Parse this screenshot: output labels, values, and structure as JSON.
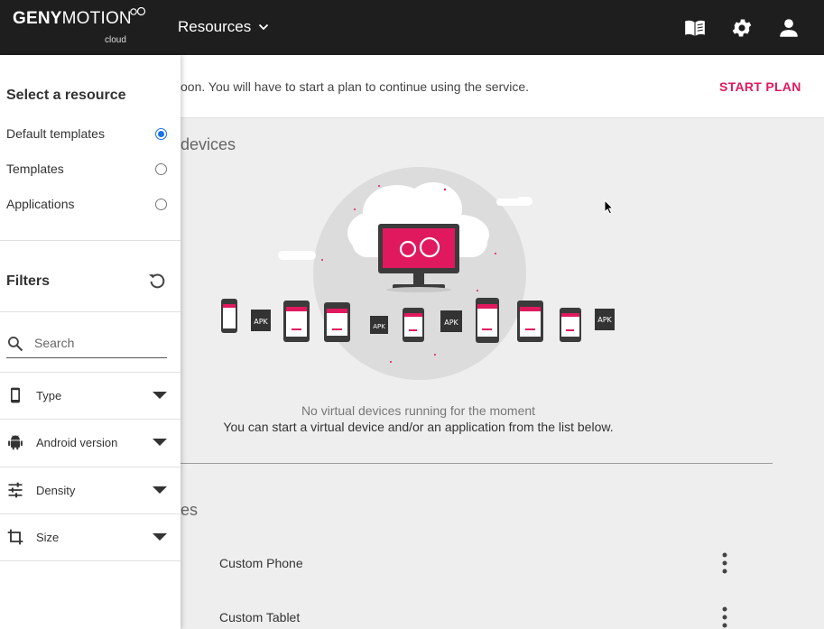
{
  "header": {
    "logo_word_bold": "GENY",
    "logo_word_light": "MOTION",
    "logo_sub": "cloud",
    "nav_label": "Resources",
    "icons": [
      "docs-book-icon",
      "settings-gear-icon",
      "account-person-icon"
    ]
  },
  "banner": {
    "text": "oon. You will have to start a plan to continue using the service.",
    "action": "START PLAN"
  },
  "main": {
    "section1_title": "devices",
    "section2_title": "es",
    "empty_line1": "No virtual devices running for the moment",
    "empty_line2": "You can start a virtual device and/or an application from the list below.",
    "apk_label": "APK",
    "templates": [
      {
        "name": "Custom Phone"
      },
      {
        "name": "Custom Tablet"
      }
    ]
  },
  "sidebar": {
    "select_heading": "Select a resource",
    "resources": [
      {
        "label": "Default templates",
        "selected": true
      },
      {
        "label": "Templates",
        "selected": false
      },
      {
        "label": "Applications",
        "selected": false
      }
    ],
    "filters_heading": "Filters",
    "search_placeholder": "Search",
    "filters": [
      {
        "label": "Type",
        "icon": "phone-icon"
      },
      {
        "label": "Android version",
        "icon": "android-icon"
      },
      {
        "label": "Density",
        "icon": "tune-sliders-icon"
      },
      {
        "label": "Size",
        "icon": "crop-icon"
      }
    ]
  },
  "colors": {
    "accent": "#e0195e",
    "topbar": "#1e1e1e",
    "radio_selected": "#1a73e8"
  }
}
